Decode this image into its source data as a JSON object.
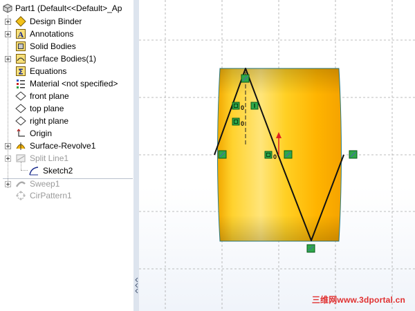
{
  "tree": {
    "title": "Part1  (Default<<Default>_Ap",
    "items": [
      {
        "label": "Design Binder",
        "icon": "design-binder-icon"
      },
      {
        "label": "Annotations",
        "icon": "annotations-icon"
      },
      {
        "label": "Solid Bodies",
        "icon": "solid-bodies-icon"
      },
      {
        "label": "Surface Bodies(1)",
        "icon": "surface-bodies-icon"
      },
      {
        "label": "Equations",
        "icon": "equations-icon"
      },
      {
        "label": "Material <not specified>",
        "icon": "material-icon"
      },
      {
        "label": "front plane",
        "icon": "plane-icon"
      },
      {
        "label": "top plane",
        "icon": "plane-icon"
      },
      {
        "label": "right plane",
        "icon": "plane-icon"
      },
      {
        "label": "Origin",
        "icon": "origin-icon"
      },
      {
        "label": "Surface-Revolve1",
        "icon": "surface-revolve-icon"
      },
      {
        "label": "Split Line1",
        "icon": "split-line-icon",
        "suppressed": true
      },
      {
        "label": "Sketch2",
        "icon": "sketch-icon"
      },
      {
        "label": "Sweep1",
        "icon": "sweep-icon",
        "suppressed": true
      },
      {
        "label": "CirPattern1",
        "icon": "circular-pattern-icon",
        "suppressed": true
      }
    ]
  },
  "viewport": {
    "relation_labels": [
      "0",
      "0",
      "0"
    ],
    "colors": {
      "body": "#f5b400",
      "handle": "#2ea84a",
      "sketch": "#111111",
      "origin_arrow": "#e02020"
    }
  },
  "watermark": "三维网www.3dportal.cn"
}
